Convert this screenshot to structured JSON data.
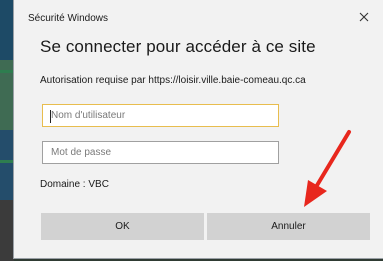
{
  "window": {
    "title": "Sécurité Windows",
    "close_glyph": "✕"
  },
  "dialog": {
    "heading": "Se connecter pour accéder à ce site",
    "subtitle": "Autorisation requise par https://loisir.ville.baie-comeau.qc.ca",
    "username": {
      "value": "",
      "placeholder": "Nom d'utilisateur"
    },
    "password": {
      "value": "",
      "placeholder": "Mot de passe"
    },
    "domain_label": "Domaine : VBC",
    "ok_label": "OK",
    "cancel_label": "Annuler"
  },
  "annotation": {
    "arrow_color": "#e8271d",
    "arrow_target": "cancel-button"
  },
  "colors": {
    "focus_border": "#e8bd4e",
    "button_bg": "#d2d2d2",
    "dialog_bg": "#f2f2f2"
  }
}
